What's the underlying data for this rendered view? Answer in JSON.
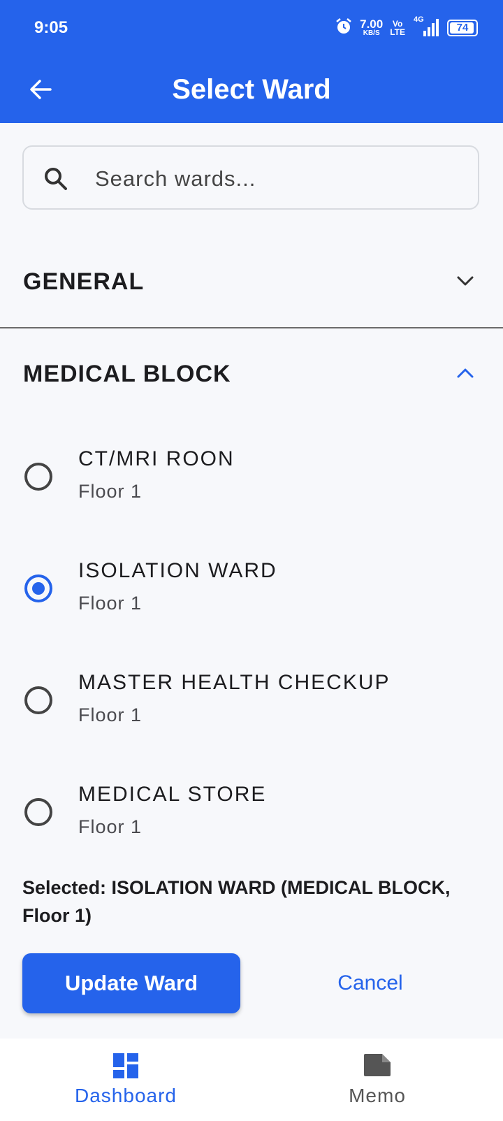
{
  "status_bar": {
    "time": "9:05",
    "net_speed": "7.00",
    "net_unit": "KB/S",
    "volte_top": "Vo",
    "volte_bottom": "LTE",
    "network": "4G",
    "battery": "74"
  },
  "header": {
    "title": "Select Ward",
    "back_icon": "arrow-left-icon"
  },
  "search": {
    "placeholder": "Search wards...",
    "value": "",
    "icon": "search-icon"
  },
  "sections": [
    {
      "title": "GENERAL",
      "expanded": false,
      "chevron": "chevron-down-icon"
    },
    {
      "title": "MEDICAL BLOCK",
      "expanded": true,
      "chevron": "chevron-up-icon",
      "wards": [
        {
          "name": "CT/MRI ROON",
          "floor": "Floor 1",
          "selected": false
        },
        {
          "name": "ISOLATION WARD",
          "floor": "Floor 1",
          "selected": true
        },
        {
          "name": "MASTER HEALTH CHECKUP",
          "floor": "Floor 1",
          "selected": false
        },
        {
          "name": "MEDICAL STORE",
          "floor": "Floor 1",
          "selected": false
        }
      ]
    }
  ],
  "selection_summary": "Selected: ISOLATION WARD (MEDICAL BLOCK, Floor 1)",
  "actions": {
    "update_label": "Update Ward",
    "cancel_label": "Cancel"
  },
  "bottom_nav": [
    {
      "label": "Dashboard",
      "icon": "dashboard-icon",
      "active": true
    },
    {
      "label": "Memo",
      "icon": "memo-icon",
      "active": false
    }
  ],
  "colors": {
    "primary": "#2563eb",
    "background": "#f7f8fb",
    "text": "#1c1c1f",
    "inactive": "#555555"
  }
}
